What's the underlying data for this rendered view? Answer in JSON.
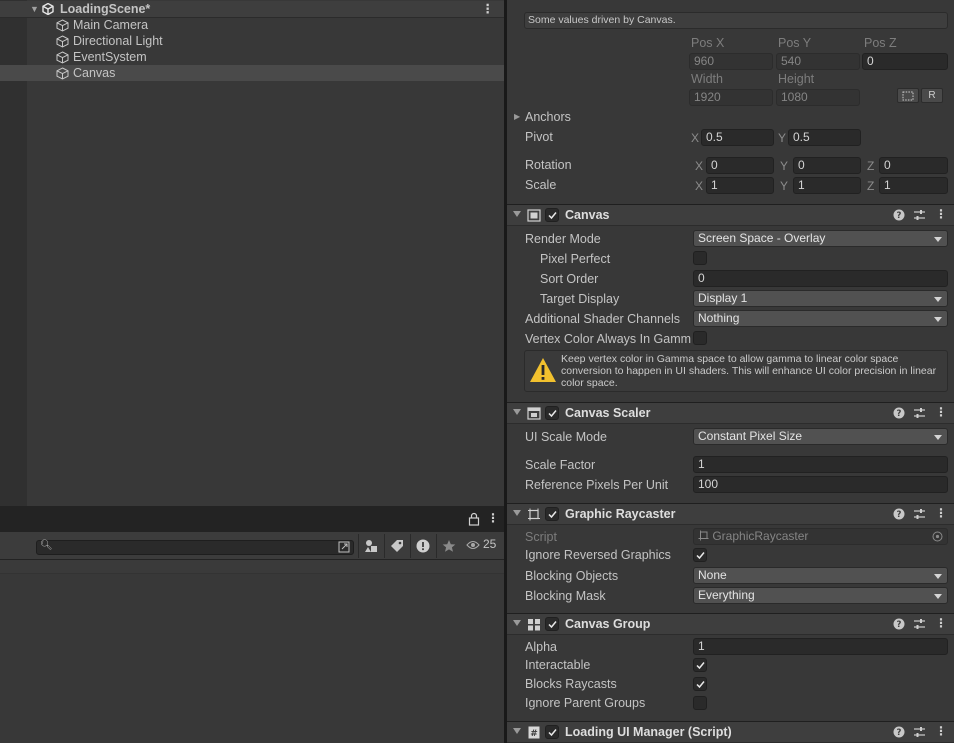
{
  "hierarchy": {
    "scene_name": "LoadingScene*",
    "items": [
      {
        "label": "Main Camera"
      },
      {
        "label": "Directional Light"
      },
      {
        "label": "EventSystem"
      },
      {
        "label": "Canvas"
      }
    ]
  },
  "bottom_panel": {
    "hidden_count": "25"
  },
  "inspector": {
    "rect_transform": {
      "driven_note": "Some values driven by Canvas.",
      "pos_x_label": "Pos X",
      "pos_y_label": "Pos Y",
      "pos_z_label": "Pos Z",
      "pos_x": "960",
      "pos_y": "540",
      "pos_z": "0",
      "width_label": "Width",
      "height_label": "Height",
      "width": "1920",
      "height": "1080",
      "r_button": "R",
      "anchors_label": "Anchors",
      "pivot_label": "Pivot",
      "pivot_x": "0.5",
      "pivot_y": "0.5",
      "rotation_label": "Rotation",
      "rot_x": "0",
      "rot_y": "0",
      "rot_z": "0",
      "scale_label": "Scale",
      "scale_x": "1",
      "scale_y": "1",
      "scale_z": "1",
      "axis_x": "X",
      "axis_y": "Y",
      "axis_z": "Z"
    },
    "canvas": {
      "title": "Canvas",
      "render_mode_label": "Render Mode",
      "render_mode": "Screen Space - Overlay",
      "pixel_perfect_label": "Pixel Perfect",
      "sort_order_label": "Sort Order",
      "sort_order": "0",
      "target_display_label": "Target Display",
      "target_display": "Display 1",
      "shader_channels_label": "Additional Shader Channels",
      "shader_channels": "Nothing",
      "vertex_color_label": "Vertex Color Always In Gamma",
      "warning": "Keep vertex color in Gamma space to allow gamma to linear color space conversion to happen in UI shaders. This will enhance UI color precision in linear color space."
    },
    "canvas_scaler": {
      "title": "Canvas Scaler",
      "ui_scale_mode_label": "UI Scale Mode",
      "ui_scale_mode": "Constant Pixel Size",
      "scale_factor_label": "Scale Factor",
      "scale_factor": "1",
      "ref_ppu_label": "Reference Pixels Per Unit",
      "ref_ppu": "100"
    },
    "graphic_raycaster": {
      "title": "Graphic Raycaster",
      "script_label": "Script",
      "script": "GraphicRaycaster",
      "ignore_reversed_label": "Ignore Reversed Graphics",
      "blocking_objects_label": "Blocking Objects",
      "blocking_objects": "None",
      "blocking_mask_label": "Blocking Mask",
      "blocking_mask": "Everything"
    },
    "canvas_group": {
      "title": "Canvas Group",
      "alpha_label": "Alpha",
      "alpha": "1",
      "interactable_label": "Interactable",
      "blocks_raycasts_label": "Blocks Raycasts",
      "ignore_parent_label": "Ignore Parent Groups"
    },
    "loading_ui_manager": {
      "title": "Loading UI Manager (Script)"
    }
  }
}
